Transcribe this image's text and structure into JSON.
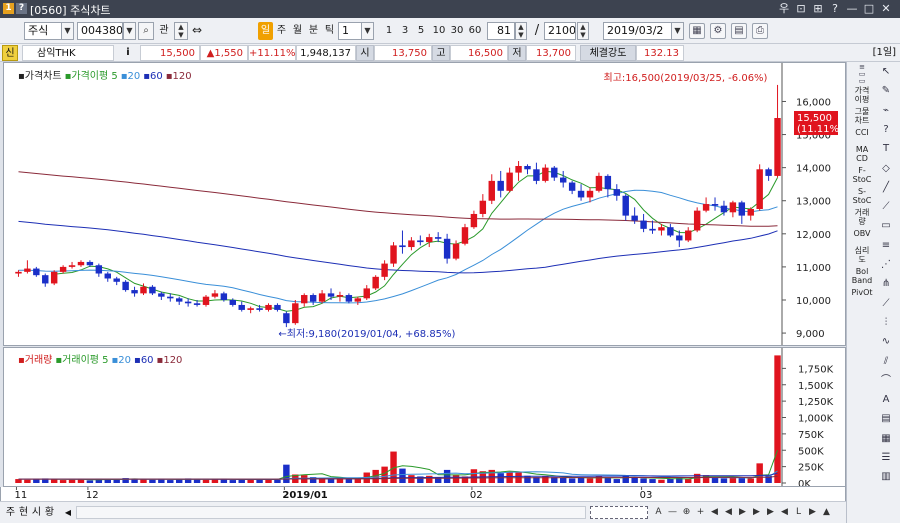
{
  "window": {
    "title": "[0560] 주식차트",
    "controls": [
      "우",
      "⊡",
      "⊞",
      "?",
      "—",
      "□",
      "✕"
    ]
  },
  "toolbar": {
    "market": "주식",
    "code": "004380",
    "search_btn": "관",
    "periods": [
      "일",
      "주",
      "월",
      "분",
      "틱",
      "년"
    ],
    "interval": "1",
    "quick_intervals": [
      "1",
      "3",
      "5",
      "10",
      "30",
      "60"
    ],
    "count": "81",
    "total": "2100",
    "date": "2019/03/2"
  },
  "quote": {
    "flag": "신",
    "name": "삼익THK",
    "info": "i",
    "price": "15,500",
    "change": "▲1,550",
    "change_pct": "+11.11%",
    "volume": "1,948,137",
    "open_label": "시",
    "open": "13,750",
    "high_label": "고",
    "high": "16,500",
    "low_label": "저",
    "low": "13,700",
    "strength_label": "체결강도",
    "strength": "132.13",
    "period_badge": "[1일]"
  },
  "price_pane": {
    "legend": [
      {
        "text": "가격차트",
        "color": "#222222"
      },
      {
        "text": "가격이평 5",
        "color": "#2a9a2a"
      },
      {
        "text": "20",
        "color": "#3a8fd8"
      },
      {
        "text": "60",
        "color": "#1d2fb5"
      },
      {
        "text": "120",
        "color": "#8a2a3a"
      }
    ],
    "y_ticks": [
      "16,000",
      "15,000",
      "14,000",
      "13,000",
      "12,000",
      "11,000",
      "10,000",
      "9,000"
    ],
    "y_range": [
      8700,
      16800
    ],
    "last_price_label": "15,500",
    "last_pct_label": "(11.11%)",
    "high_annotation": "최고:16,500(2019/03/25, -6.06%)",
    "low_annotation": "최저:9,180(2019/01/04, +68.85%)"
  },
  "volume_pane": {
    "legend": [
      {
        "text": "거래량",
        "color": "#d01e1e"
      },
      {
        "text": "거래이평 5",
        "color": "#2a9a2a"
      },
      {
        "text": "20",
        "color": "#3a8fd8"
      },
      {
        "text": "60",
        "color": "#1d2fb5"
      },
      {
        "text": "120",
        "color": "#8a2a3a"
      }
    ],
    "y_ticks": [
      "1,750K",
      "1,500K",
      "1,250K",
      "1,000K",
      "750K",
      "500K",
      "250K",
      "0K"
    ],
    "y_range": [
      0,
      2000000
    ]
  },
  "x_axis": {
    "labels": [
      {
        "text": "11",
        "idx": 0
      },
      {
        "text": "12",
        "idx": 8
      },
      {
        "text": "2019/01",
        "idx": 30
      },
      {
        "text": "02",
        "idx": 51
      },
      {
        "text": "03",
        "idx": 70
      }
    ]
  },
  "right_toolbar": {
    "buttons": [
      "가격\n이평",
      "그물\n차트",
      "CCI",
      "MA\nCD",
      "F-\nStoC",
      "S-\nStoC",
      "거래\n량",
      "OBV",
      "심리\n도",
      "Bol\nBand",
      "PivOt"
    ]
  },
  "bottom_bar": {
    "tabs": [
      "주",
      "현",
      "시",
      "황"
    ],
    "zoom_buttons": [
      "A",
      "—",
      "⊕",
      "+",
      "◀",
      "◀",
      "▶",
      "▶",
      "▶",
      "◀",
      "L",
      "▶",
      "▲"
    ]
  },
  "chart_data": {
    "type": "candlestick",
    "colors": {
      "up": "#e0141e",
      "down": "#1a2fc8"
    },
    "candles": [
      [
        10800,
        10900,
        10700,
        10850
      ],
      [
        10850,
        11200,
        10800,
        10950
      ],
      [
        10950,
        11000,
        10700,
        10750
      ],
      [
        10750,
        10800,
        10400,
        10500
      ],
      [
        10500,
        10900,
        10450,
        10850
      ],
      [
        10850,
        11050,
        10800,
        11000
      ],
      [
        11000,
        11150,
        10950,
        11050
      ],
      [
        11050,
        11200,
        11000,
        11150
      ],
      [
        11150,
        11200,
        11000,
        11050
      ],
      [
        11050,
        11100,
        10700,
        10800
      ],
      [
        10800,
        10850,
        10550,
        10650
      ],
      [
        10650,
        10700,
        10450,
        10550
      ],
      [
        10550,
        10600,
        10250,
        10300
      ],
      [
        10300,
        10400,
        10100,
        10200
      ],
      [
        10200,
        10500,
        10150,
        10400
      ],
      [
        10400,
        10450,
        10150,
        10200
      ],
      [
        10200,
        10250,
        10000,
        10100
      ],
      [
        10100,
        10200,
        9950,
        10050
      ],
      [
        10050,
        10100,
        9850,
        9950
      ],
      [
        9950,
        10050,
        9800,
        9900
      ],
      [
        9900,
        10000,
        9800,
        9850
      ],
      [
        9850,
        10150,
        9800,
        10100
      ],
      [
        10100,
        10300,
        10050,
        10200
      ],
      [
        10200,
        10250,
        9950,
        10000
      ],
      [
        10000,
        10050,
        9800,
        9850
      ],
      [
        9850,
        9950,
        9650,
        9700
      ],
      [
        9700,
        9800,
        9600,
        9750
      ],
      [
        9750,
        9850,
        9650,
        9700
      ],
      [
        9700,
        9900,
        9650,
        9850
      ],
      [
        9850,
        9900,
        9650,
        9700
      ],
      [
        9600,
        9650,
        9180,
        9300
      ],
      [
        9300,
        10000,
        9250,
        9900
      ],
      [
        9900,
        10200,
        9800,
        10150
      ],
      [
        10150,
        10200,
        9850,
        9950
      ],
      [
        9950,
        10300,
        9900,
        10200
      ],
      [
        10200,
        10350,
        10000,
        10100
      ],
      [
        10100,
        10250,
        9950,
        10150
      ],
      [
        10150,
        10200,
        9900,
        9950
      ],
      [
        9950,
        10100,
        9850,
        10050
      ],
      [
        10050,
        10450,
        10000,
        10350
      ],
      [
        10350,
        10750,
        10300,
        10700
      ],
      [
        10700,
        11200,
        10600,
        11100
      ],
      [
        11100,
        11750,
        11000,
        11650
      ],
      [
        11650,
        12100,
        11400,
        11600
      ],
      [
        11600,
        11900,
        11500,
        11800
      ],
      [
        11800,
        11950,
        11650,
        11750
      ],
      [
        11750,
        12000,
        11600,
        11900
      ],
      [
        11900,
        12050,
        11750,
        11850
      ],
      [
        11850,
        12000,
        11100,
        11250
      ],
      [
        11250,
        11800,
        11200,
        11700
      ],
      [
        11700,
        12300,
        11650,
        12200
      ],
      [
        12200,
        12700,
        12150,
        12600
      ],
      [
        12600,
        13200,
        12500,
        13000
      ],
      [
        13000,
        13800,
        12900,
        13600
      ],
      [
        13600,
        13900,
        13100,
        13300
      ],
      [
        13300,
        14000,
        13250,
        13850
      ],
      [
        13850,
        14200,
        13600,
        14050
      ],
      [
        14050,
        14100,
        13800,
        13950
      ],
      [
        13950,
        14150,
        13500,
        13600
      ],
      [
        13600,
        14100,
        13550,
        14000
      ],
      [
        14000,
        14050,
        13600,
        13700
      ],
      [
        13700,
        13900,
        13400,
        13550
      ],
      [
        13550,
        13600,
        13200,
        13300
      ],
      [
        13300,
        13500,
        13000,
        13100
      ],
      [
        13100,
        13400,
        12950,
        13300
      ],
      [
        13300,
        13850,
        13250,
        13750
      ],
      [
        13750,
        13800,
        13100,
        13350
      ],
      [
        13350,
        13500,
        13000,
        13150
      ],
      [
        13150,
        13200,
        12400,
        12550
      ],
      [
        12550,
        12800,
        12300,
        12400
      ],
      [
        12400,
        12600,
        12050,
        12150
      ],
      [
        12150,
        12400,
        12000,
        12100
      ],
      [
        12100,
        12300,
        11950,
        12200
      ],
      [
        12200,
        12300,
        11900,
        11950
      ],
      [
        11950,
        12100,
        11600,
        11800
      ],
      [
        11800,
        12200,
        11750,
        12100
      ],
      [
        12100,
        12800,
        12050,
        12700
      ],
      [
        12700,
        13100,
        12650,
        12900
      ],
      [
        12900,
        13100,
        12700,
        12850
      ],
      [
        12850,
        13000,
        12550,
        12650
      ],
      [
        12650,
        13000,
        12500,
        12950
      ],
      [
        12950,
        13000,
        12300,
        12550
      ],
      [
        12550,
        12800,
        12400,
        12750
      ],
      [
        12750,
        14100,
        12700,
        13950
      ],
      [
        13950,
        14000,
        13600,
        13750
      ],
      [
        13750,
        16500,
        13700,
        15500
      ]
    ],
    "volumes": [
      60000,
      50000,
      55000,
      70000,
      60000,
      45000,
      50000,
      55000,
      40000,
      65000,
      60000,
      50000,
      75000,
      60000,
      55000,
      50000,
      65000,
      45000,
      60000,
      70000,
      60000,
      50000,
      55000,
      65000,
      45000,
      55000,
      50000,
      60000,
      55000,
      50000,
      280000,
      130000,
      120000,
      90000,
      80000,
      70000,
      75000,
      60000,
      60000,
      160000,
      200000,
      250000,
      480000,
      220000,
      120000,
      100000,
      110000,
      90000,
      200000,
      120000,
      100000,
      210000,
      180000,
      200000,
      150000,
      170000,
      160000,
      110000,
      90000,
      100000,
      90000,
      80000,
      70000,
      80000,
      70000,
      100000,
      80000,
      60000,
      100000,
      90000,
      70000,
      60000,
      50000,
      65000,
      80000,
      60000,
      140000,
      120000,
      80000,
      70000,
      80000,
      75000,
      70000,
      300000,
      110000,
      1948137
    ],
    "ma_periods": [
      5,
      20,
      60,
      120
    ]
  }
}
